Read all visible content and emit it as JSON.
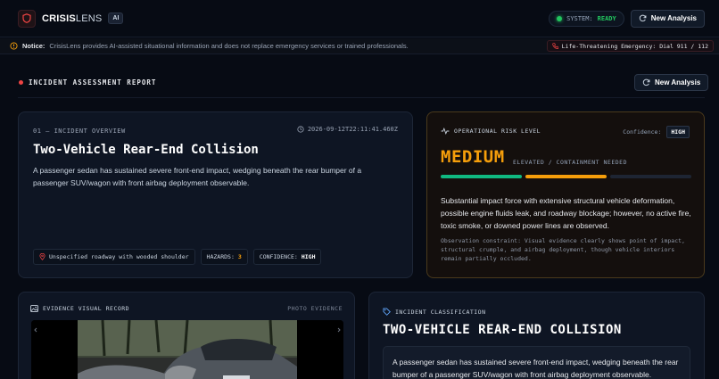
{
  "header": {
    "brand_bold": "CRISIS",
    "brand_thin": "LENS",
    "brand_badge": "AI",
    "status_label": "SYSTEM:",
    "status_value": "READY",
    "new_analysis_label": "New Analysis"
  },
  "notice": {
    "label": "Notice:",
    "text": "CrisisLens provides AI-assisted situational information and does not replace emergency services or trained professionals.",
    "emergency": "Life-Threatening Emergency: Dial 911 / 112"
  },
  "report": {
    "title": "INCIDENT ASSESSMENT REPORT",
    "new_analysis_label": "New Analysis"
  },
  "overview": {
    "label": "01 — INCIDENT OVERVIEW",
    "timestamp": "2026-09-12T22:11:41.460Z",
    "title": "Two-Vehicle Rear-End Collision",
    "description": "A passenger sedan has sustained severe front-end impact, wedging beneath the rear bumper of a passenger SUV/wagon with front airbag deployment observable.",
    "location": "Unspecified roadway with wooded shoulder",
    "hazards_label": "HAZARDS:",
    "hazards_value": "3",
    "confidence_label": "CONFIDENCE:",
    "confidence_value": "HIGH"
  },
  "risk": {
    "label": "OPERATIONAL RISK LEVEL",
    "confidence_label": "Confidence:",
    "confidence_value": "HIGH",
    "level": "MEDIUM",
    "sub": "ELEVATED / CONTAINMENT NEEDED",
    "level_fraction": 0.67,
    "bar_colors": [
      "#10b981",
      "#f59e0b",
      "#1e2533"
    ],
    "description": "Substantial impact force with extensive structural vehicle deformation, possible engine fluids leak, and roadway blockage; however, no active fire, toxic smoke, or downed power lines are observed.",
    "observation": "Observation constraint: Visual evidence clearly shows point of impact, structural crumple, and airbag deployment, though vehicle interiors remain partially occluded."
  },
  "evidence": {
    "label": "EVIDENCE VISUAL RECORD",
    "right_label": "PHOTO EVIDENCE"
  },
  "classification": {
    "label": "INCIDENT CLASSIFICATION",
    "title": "TWO-VEHICLE REAR-END COLLISION",
    "description": "A passenger sedan has sustained severe front-end impact, wedging beneath the rear bumper of a passenger SUV/wagon with front airbag deployment observable."
  },
  "colors": {
    "accent_amber": "#f59e0b",
    "ready_green": "#22c55e",
    "alert_red": "#ef4444",
    "background": "#070b14"
  },
  "icons": [
    "shield-icon",
    "refresh-icon",
    "warning-icon",
    "phone-icon",
    "clock-icon",
    "map-pin-icon",
    "activity-icon",
    "image-icon",
    "tag-icon"
  ]
}
